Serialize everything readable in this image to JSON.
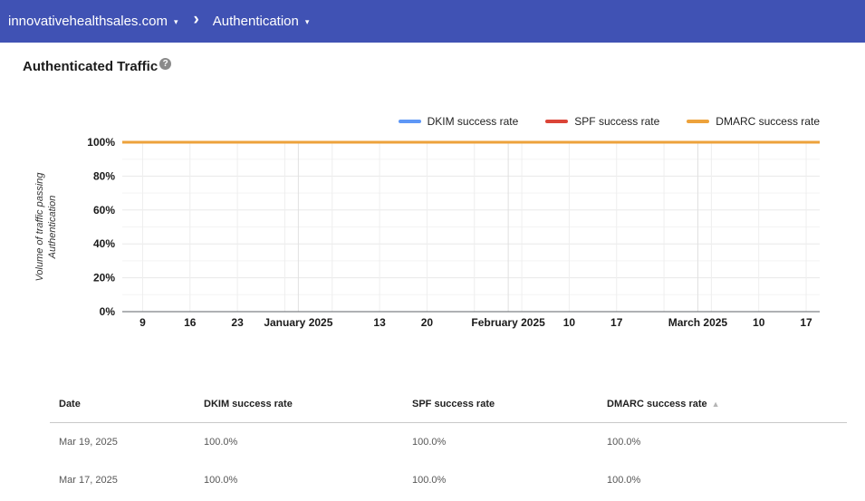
{
  "header": {
    "bar_color": "#4052b4",
    "domain_selector": "innovativehealthsales.com",
    "section_selector": "Authentication",
    "caret_icon": "▾",
    "separator_chevron": "›"
  },
  "page": {
    "title": "Authenticated Traffic"
  },
  "chart_data": {
    "type": "line",
    "title": "Authenticated Traffic",
    "ylabel": "Volume of traffic passing Authentication",
    "ylabel_lines": [
      "Volume of traffic passing",
      "Authentication"
    ],
    "ylim": [
      0,
      100
    ],
    "y_minor_step": 10,
    "y_ticks": [
      {
        "percent": 0,
        "label": "0%"
      },
      {
        "percent": 20,
        "label": "20%"
      },
      {
        "percent": 40,
        "label": "40%"
      },
      {
        "percent": 60,
        "label": "60%"
      },
      {
        "percent": 80,
        "label": "80%"
      },
      {
        "percent": 100,
        "label": "100%"
      }
    ],
    "x_axis": {
      "range_days": 103,
      "gridlines": [
        {
          "day": 3,
          "label": "9",
          "month_start": false
        },
        {
          "day": 10,
          "label": "16",
          "month_start": false
        },
        {
          "day": 17,
          "label": "23",
          "month_start": false
        },
        {
          "day": 24,
          "label": "",
          "month_start": false
        },
        {
          "day": 26,
          "label": "January 2025",
          "month_start": true
        },
        {
          "day": 31,
          "label": "",
          "month_start": false
        },
        {
          "day": 38,
          "label": "13",
          "month_start": false
        },
        {
          "day": 45,
          "label": "20",
          "month_start": false
        },
        {
          "day": 52,
          "label": "",
          "month_start": false
        },
        {
          "day": 57,
          "label": "February 2025",
          "month_start": true
        },
        {
          "day": 59,
          "label": "",
          "month_start": false
        },
        {
          "day": 66,
          "label": "10",
          "month_start": false
        },
        {
          "day": 73,
          "label": "17",
          "month_start": false
        },
        {
          "day": 80,
          "label": "",
          "month_start": false
        },
        {
          "day": 85,
          "label": "March 2025",
          "month_start": true
        },
        {
          "day": 87,
          "label": "",
          "month_start": false
        },
        {
          "day": 94,
          "label": "10",
          "month_start": false
        },
        {
          "day": 101,
          "label": "17",
          "month_start": false
        }
      ]
    },
    "legend": [
      {
        "name": "DKIM success rate",
        "color": "#5e97f6"
      },
      {
        "name": "SPF success rate",
        "color": "#db4437"
      },
      {
        "name": "DMARC success rate",
        "color": "#eda23b"
      }
    ],
    "series": [
      {
        "name": "DKIM success rate",
        "color": "#5e97f6",
        "value_percent": 100
      },
      {
        "name": "SPF success rate",
        "color": "#db4437",
        "value_percent": 100
      },
      {
        "name": "DMARC success rate",
        "color": "#eda23b",
        "value_percent": 100
      }
    ]
  },
  "table": {
    "columns": [
      {
        "label": "Date"
      },
      {
        "label": "DKIM success rate"
      },
      {
        "label": "SPF success rate"
      },
      {
        "label": "DMARC success rate"
      }
    ],
    "sort_icon": "▲",
    "rows": [
      {
        "date": "Mar 19, 2025",
        "dkim": "100.0%",
        "spf": "100.0%",
        "dmarc": "100.0%"
      },
      {
        "date": "Mar 17, 2025",
        "dkim": "100.0%",
        "spf": "100.0%",
        "dmarc": "100.0%"
      }
    ]
  }
}
